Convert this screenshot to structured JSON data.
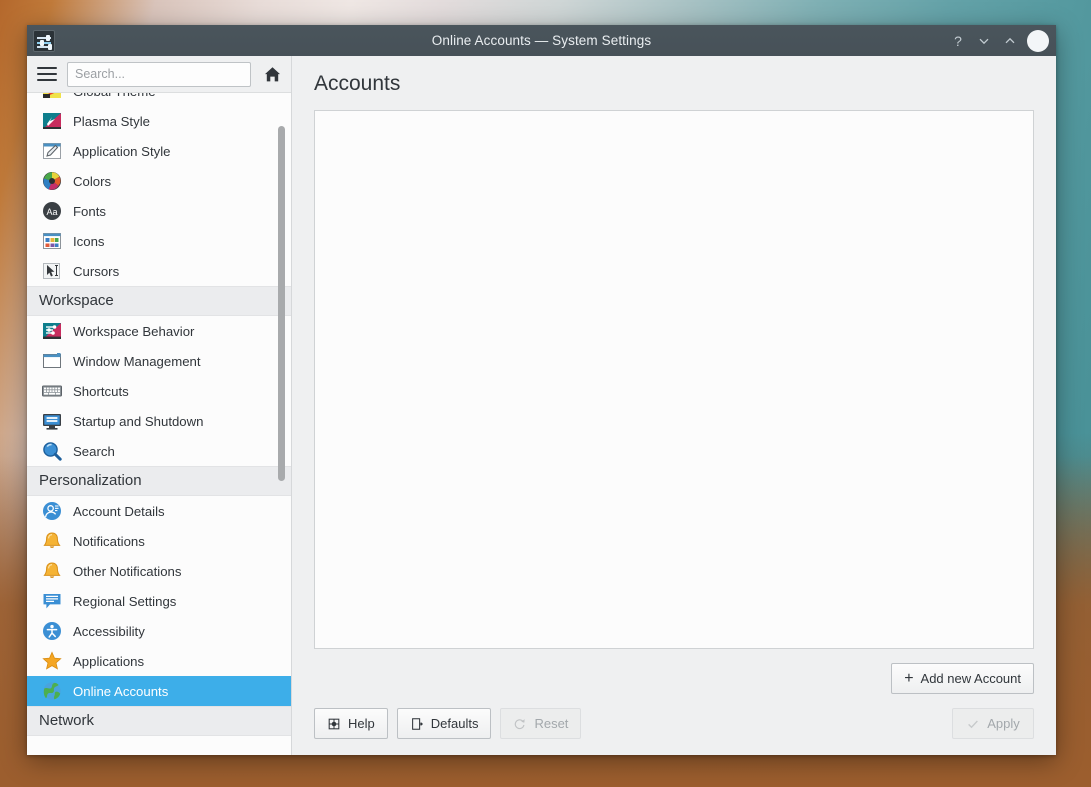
{
  "window": {
    "title": "Online Accounts — System Settings",
    "app_icon": "system-settings-icon",
    "buttons": {
      "help": "?",
      "minimize": "minimize-icon",
      "maximize": "maximize-icon",
      "close": "close-icon"
    }
  },
  "sidebar": {
    "menu_label": "hamburger-menu",
    "search": {
      "value": "",
      "placeholder": "Search..."
    },
    "home_label": "home-icon",
    "groups": [
      {
        "header": null,
        "items": [
          {
            "label": "Global Theme",
            "icon": "global-theme-icon",
            "selected": false,
            "partial": true
          },
          {
            "label": "Plasma Style",
            "icon": "plasma-style-icon",
            "selected": false
          },
          {
            "label": "Application Style",
            "icon": "application-style-icon",
            "selected": false
          },
          {
            "label": "Colors",
            "icon": "colors-icon",
            "selected": false
          },
          {
            "label": "Fonts",
            "icon": "fonts-icon",
            "selected": false
          },
          {
            "label": "Icons",
            "icon": "icons-icon",
            "selected": false
          },
          {
            "label": "Cursors",
            "icon": "cursors-icon",
            "selected": false
          }
        ]
      },
      {
        "header": "Workspace",
        "items": [
          {
            "label": "Workspace Behavior",
            "icon": "workspace-behavior-icon",
            "selected": false
          },
          {
            "label": "Window Management",
            "icon": "window-management-icon",
            "selected": false
          },
          {
            "label": "Shortcuts",
            "icon": "shortcuts-icon",
            "selected": false
          },
          {
            "label": "Startup and Shutdown",
            "icon": "startup-shutdown-icon",
            "selected": false
          },
          {
            "label": "Search",
            "icon": "search-icon",
            "selected": false
          }
        ]
      },
      {
        "header": "Personalization",
        "items": [
          {
            "label": "Account Details",
            "icon": "account-details-icon",
            "selected": false
          },
          {
            "label": "Notifications",
            "icon": "notifications-icon",
            "selected": false
          },
          {
            "label": "Other Notifications",
            "icon": "other-notifications-icon",
            "selected": false
          },
          {
            "label": "Regional Settings",
            "icon": "regional-settings-icon",
            "selected": false
          },
          {
            "label": "Accessibility",
            "icon": "accessibility-icon",
            "selected": false
          },
          {
            "label": "Applications",
            "icon": "applications-icon",
            "selected": false
          },
          {
            "label": "Online Accounts",
            "icon": "online-accounts-icon",
            "selected": true
          }
        ]
      },
      {
        "header": "Network",
        "items": []
      }
    ]
  },
  "main": {
    "page_title": "Accounts",
    "content_empty": true,
    "add_account_button": "Add new Account",
    "bottom_buttons": [
      {
        "label": "Help",
        "icon": "help-icon",
        "enabled": true
      },
      {
        "label": "Defaults",
        "icon": "defaults-icon",
        "enabled": true
      },
      {
        "label": "Reset",
        "icon": "reset-icon",
        "enabled": false
      }
    ],
    "apply_button": {
      "label": "Apply",
      "icon": "check-icon",
      "enabled": false
    }
  },
  "colors": {
    "accent": "#3daee9",
    "titlebar": "#475158",
    "window_bg": "#eff0f1",
    "sidebar_bg": "#fcfcfc",
    "section_header_bg": "#ebecee",
    "text": "#31363b"
  }
}
